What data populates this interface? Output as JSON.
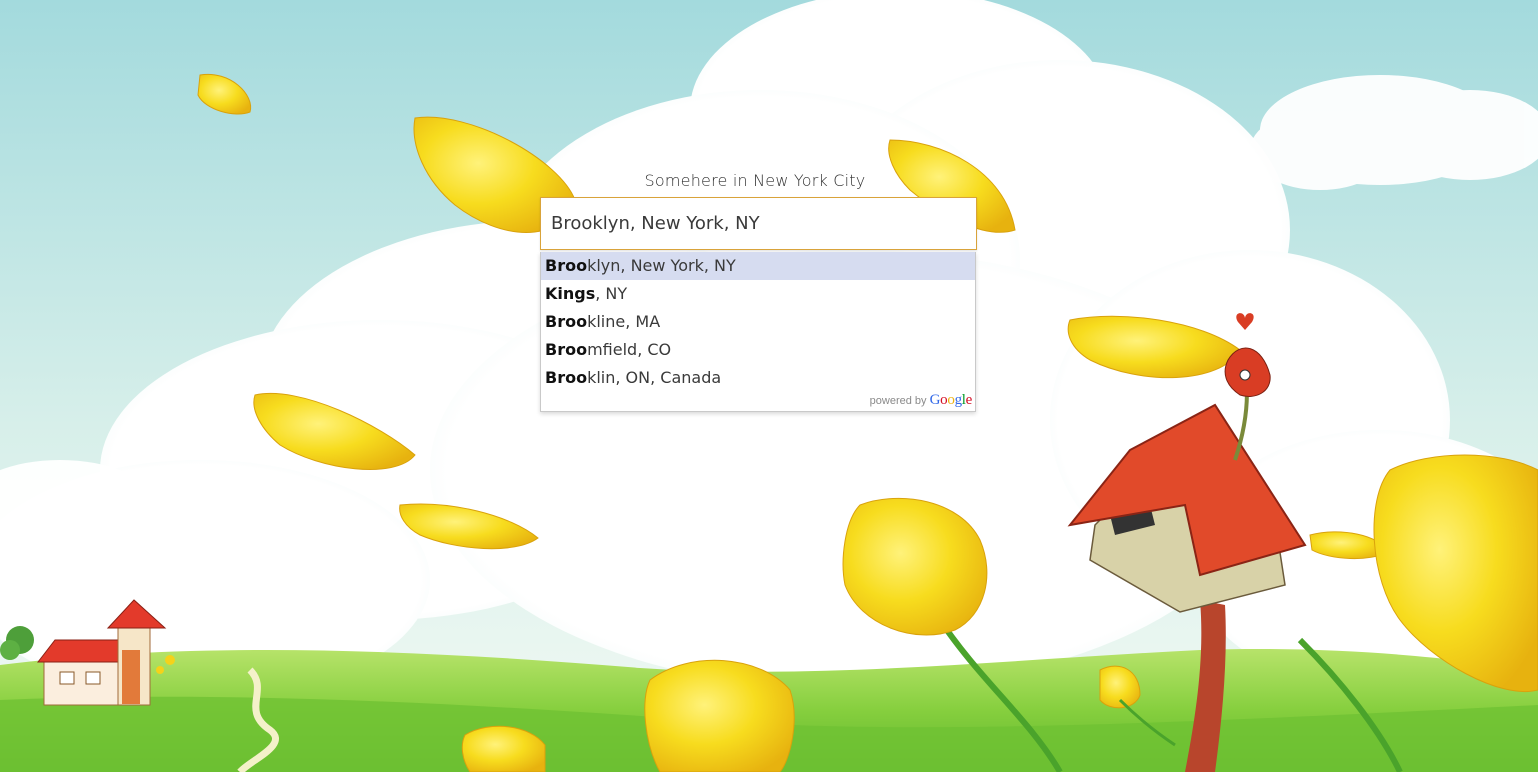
{
  "search": {
    "label": "Somehere in New York City",
    "value": "Brooklyn, New York, NY"
  },
  "suggestions": [
    {
      "match": "Broo",
      "rest": "klyn, New York, NY",
      "selected": true
    },
    {
      "match": "Kings",
      "rest": ", NY",
      "selected": false
    },
    {
      "match": "Broo",
      "rest": "kline, MA",
      "selected": false
    },
    {
      "match": "Broo",
      "rest": "mfield, CO",
      "selected": false
    },
    {
      "match": "Broo",
      "rest": "klin, ON, Canada",
      "selected": false
    }
  ],
  "attribution": {
    "prefix": "powered by",
    "logo_letters": [
      "G",
      "o",
      "o",
      "g",
      "l",
      "e"
    ],
    "logo_colors": [
      "#3369e8",
      "#d50f25",
      "#eeb211",
      "#3369e8",
      "#009925",
      "#d50f25"
    ]
  },
  "colors": {
    "sky_top": "#a9dde0",
    "sky_bottom": "#eef8f3",
    "grass": "#7fcf3e",
    "petal": "#f5d81a",
    "roof": "#e0452a",
    "selected_row": "#d6dcf0",
    "input_border": "#d9a33a"
  }
}
